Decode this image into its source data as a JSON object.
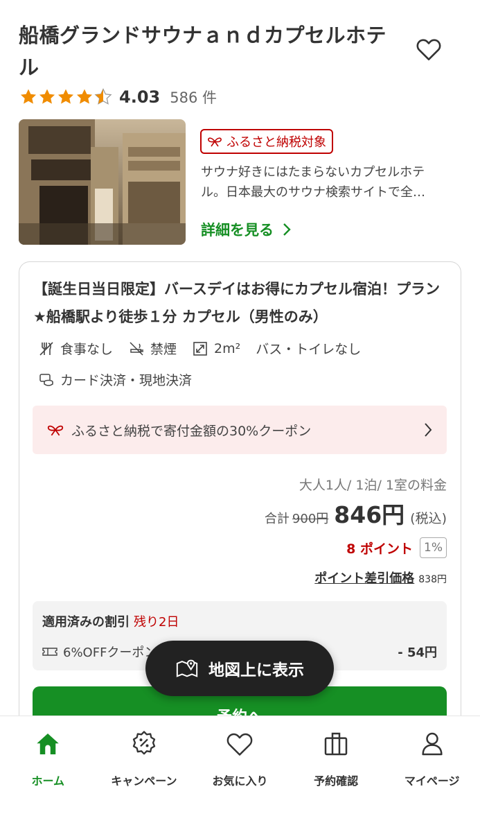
{
  "hotel": {
    "title": "船橋グランドサウナａｎｄカプセルホテル",
    "rating": "4.03",
    "review_count": "586 件",
    "badge": "ふるさと納税対象",
    "description_line1": "サウナ好きにはたまらないカプセルホテ",
    "description_line2": "ル。日本最大のサウナ検索サイトで全…",
    "details_link": "詳細を見る"
  },
  "plan": {
    "title": "【誕生日当日限定】バースデイはお得にカプセル宿泊！プラン★船橋駅より徒歩１分 カプセル（男性のみ）",
    "features": {
      "meal": "食事なし",
      "smoking": "禁煙",
      "area": "2m²",
      "bath": "バス・トイレなし",
      "payment": "カード決済・現地決済"
    },
    "coupon_banner": "ふるさと納税で寄付金額の30%クーポン",
    "price_condition": "大人1人/ 1泊/ 1室の料金",
    "total_label": "合計",
    "original_price": "900円",
    "price": "846円",
    "tax_label": "(税込)",
    "points": "8 ポイント",
    "points_rate": "1%",
    "point_discount_label": "ポイント差引価格",
    "point_discount_value": "838円",
    "applied": {
      "title": "適用済みの割引",
      "remaining": "残り2日",
      "coupon_name": "6%OFFクーポン",
      "amount": "- 54円"
    },
    "reserve_label": "予約へ"
  },
  "map_button": "地図上に表示",
  "nav": {
    "items": [
      {
        "label": "ホーム",
        "icon": "home-icon",
        "active": true
      },
      {
        "label": "キャンペーン",
        "icon": "campaign-percent-icon",
        "active": false
      },
      {
        "label": "お気に入り",
        "icon": "heart-icon",
        "active": false
      },
      {
        "label": "予約確認",
        "icon": "booking-bag-icon",
        "active": false
      },
      {
        "label": "マイページ",
        "icon": "person-icon",
        "active": false
      }
    ]
  },
  "colors": {
    "brand_green": "#168f24",
    "red": "#bf0000",
    "star": "#f08c00",
    "coupon_bg": "#fcecec"
  },
  "stars_filled": 4.5
}
